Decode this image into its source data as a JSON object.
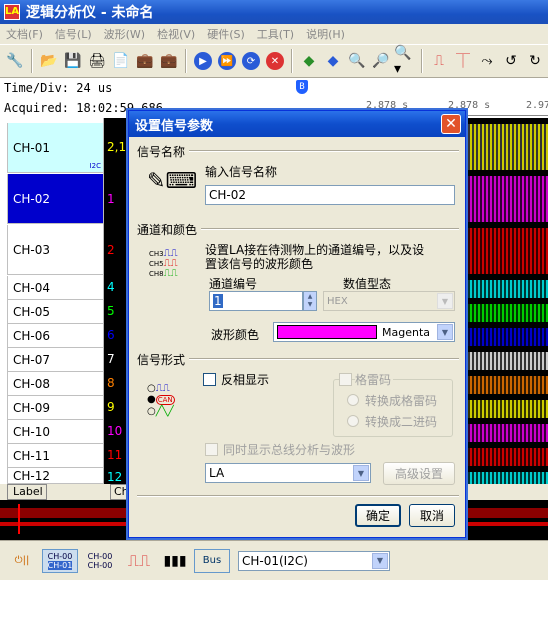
{
  "window": {
    "title": "逻辑分析仪 - 未命名",
    "app_icon": "LA"
  },
  "menu": [
    "文档(F)",
    "信号(L)",
    "波形(W)",
    "检视(V)",
    "硬件(S)",
    "工具(T)",
    "说明(H)"
  ],
  "info": {
    "time_div": "Time/Div: 24 us",
    "acquired": "Acquired: 18:02:59 686",
    "ruler_ticks": [
      "2.878 s",
      "2.878 s",
      "2.97"
    ]
  },
  "channels": [
    {
      "name": "CH-01",
      "num": "2,1",
      "tag": "I2C",
      "num_color": "#ffff00"
    },
    {
      "name": "CH-02",
      "num": "1",
      "num_color": "#ff00ff"
    },
    {
      "name": "CH-03",
      "num": "2",
      "num_color": "#ff0000"
    },
    {
      "name": "CH-04",
      "num": "4",
      "num_color": "#00ffff"
    },
    {
      "name": "CH-05",
      "num": "5",
      "num_color": "#00ff00"
    },
    {
      "name": "CH-06",
      "num": "6",
      "num_color": "#0000ff"
    },
    {
      "name": "CH-07",
      "num": "7",
      "num_color": "#ffffff"
    },
    {
      "name": "CH-08",
      "num": "8",
      "num_color": "#ff8000"
    },
    {
      "name": "CH-09",
      "num": "9",
      "num_color": "#ffff00"
    },
    {
      "name": "CH-10",
      "num": "10",
      "num_color": "#ff00ff"
    },
    {
      "name": "CH-11",
      "num": "11",
      "num_color": "#ff0000"
    },
    {
      "name": "CH-12",
      "num": "12",
      "num_color": "#00ffff"
    }
  ],
  "bottom": {
    "label_button": "Label",
    "ch_button": "Ch",
    "icon_ch_a_top": "CH-00",
    "icon_ch_a_bottom": "CH-01",
    "icon_ch_b_top": "CH-00",
    "icon_ch_b_bottom": "CH-00",
    "bus_icon": "Bus",
    "channel_select": "CH-01(I2C)"
  },
  "dialog": {
    "title": "设置信号参数",
    "sec_name": "信号名称",
    "name_prompt": "输入信号名称",
    "name_value": "CH-02",
    "sec_channel": "通道和颜色",
    "channel_desc_1": "设置LA接在待测物上的通道编号，以及设",
    "channel_desc_2": "置该信号的波形颜色",
    "channel_num_label": "通道编号",
    "channel_num_value": "1",
    "value_type_label": "数值型态",
    "value_type_value": "HEX",
    "wave_color_label": "波形颜色",
    "wave_color_value": "Magenta",
    "wave_color_hex": "#ff00ff",
    "sec_form": "信号形式",
    "invert_label": "反相显示",
    "gray_code_label": "格雷码",
    "to_gray": "转换成格雷码",
    "to_binary": "转换成二进码",
    "bus_wave_label": "同时显示总线分析与波形",
    "mode_value": "LA",
    "advanced_button": "高级设置",
    "ok_button": "确定",
    "cancel_button": "取消",
    "icon_ch_labels": [
      "CH3",
      "CH5",
      "CH8"
    ],
    "icon_can_label": "CAN"
  },
  "colors": {
    "selected_row": "#0000cc",
    "first_row": "#ccffff",
    "title_bar": "#1952c4"
  }
}
